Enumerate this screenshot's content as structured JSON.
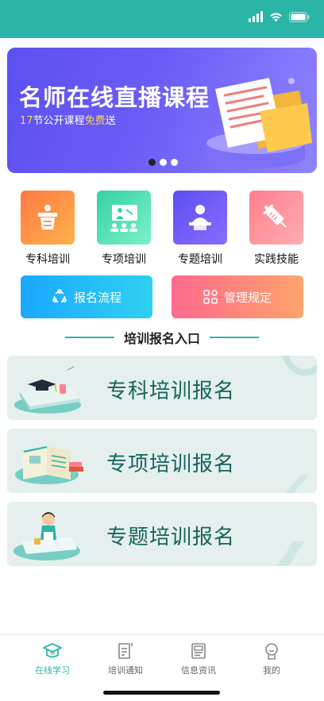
{
  "banner": {
    "title": "名师在线直播课程",
    "subtitle_count": "17",
    "subtitle_mid": "节公开课程",
    "subtitle_highlight": "免费",
    "subtitle_end": "送",
    "page_index": 1,
    "page_total": 3
  },
  "categories": [
    {
      "label": "专科培训",
      "icon": "lectern-icon",
      "color_from": "#ff7a45",
      "color_to": "#ffb14a"
    },
    {
      "label": "专项培训",
      "icon": "classroom-icon",
      "color_from": "#33d2a5",
      "color_to": "#7ef0c8"
    },
    {
      "label": "专题培训",
      "icon": "presenter-icon",
      "color_from": "#5b50f0",
      "color_to": "#8a6cff"
    },
    {
      "label": "实践技能",
      "icon": "syringe-icon",
      "color_from": "#ff7f8d",
      "color_to": "#ffadae"
    }
  ],
  "actions": {
    "process_label": "报名流程",
    "rules_label": "管理规定"
  },
  "section_title": "培训报名入口",
  "cards": [
    {
      "label": "专科培训报名",
      "icon": "graduation-books-icon"
    },
    {
      "label": "专项培训报名",
      "icon": "open-book-icon"
    },
    {
      "label": "专题培训报名",
      "icon": "student-reading-icon"
    }
  ],
  "tabs": [
    {
      "label": "在线学习",
      "icon": "graduation-cap-icon",
      "active": true
    },
    {
      "label": "培训通知",
      "icon": "notice-doc-icon",
      "active": false
    },
    {
      "label": "信息资讯",
      "icon": "news-icon",
      "active": false
    },
    {
      "label": "我的",
      "icon": "profile-icon",
      "active": false
    }
  ],
  "colors": {
    "brand": "#2bb5a8",
    "card_bg": "#e4efee",
    "card_text": "#17645c"
  }
}
